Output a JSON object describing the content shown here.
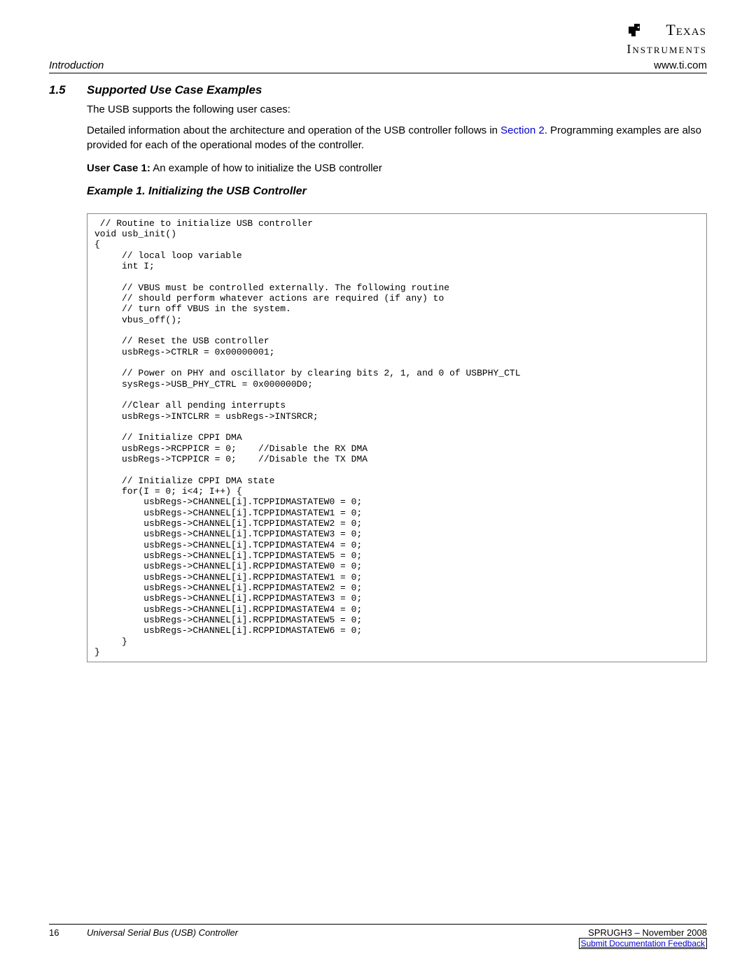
{
  "logo": {
    "line1": "Texas",
    "line2": "Instruments"
  },
  "header": {
    "left": "Introduction",
    "right": "www.ti.com"
  },
  "section": {
    "number": "1.5",
    "title": "Supported Use Case Examples"
  },
  "paragraphs": {
    "p1": "The USB supports the following user cases:",
    "p2a": "Detailed information about the architecture and operation of the USB controller follows in ",
    "p2_link": "Section 2",
    "p2b": ". Programming examples are also provided for each of the operational modes of the controller.",
    "user_case_label": "User Case 1:",
    "user_case_text": " An example of how to initialize the USB controller",
    "example_title": "Example 1. Initializing the USB Controller"
  },
  "code": " // Routine to initialize USB controller\nvoid usb_init()\n{\n     // local loop variable\n     int I;\n\n     // VBUS must be controlled externally. The following routine\n     // should perform whatever actions are required (if any) to\n     // turn off VBUS in the system.\n     vbus_off();\n\n     // Reset the USB controller\n     usbRegs->CTRLR = 0x00000001;\n\n     // Power on PHY and oscillator by clearing bits 2, 1, and 0 of USBPHY_CTL\n     sysRegs->USB_PHY_CTRL = 0x000000D0;\n\n     //Clear all pending interrupts\n     usbRegs->INTCLRR = usbRegs->INTSRCR;\n\n     // Initialize CPPI DMA\n     usbRegs->RCPPICR = 0;    //Disable the RX DMA\n     usbRegs->TCPPICR = 0;    //Disable the TX DMA\n\n     // Initialize CPPI DMA state\n     for(I = 0; i<4; I++) {\n         usbRegs->CHANNEL[i].TCPPIDMASTATEW0 = 0;\n         usbRegs->CHANNEL[i].TCPPIDMASTATEW1 = 0;\n         usbRegs->CHANNEL[i].TCPPIDMASTATEW2 = 0;\n         usbRegs->CHANNEL[i].TCPPIDMASTATEW3 = 0;\n         usbRegs->CHANNEL[i].TCPPIDMASTATEW4 = 0;\n         usbRegs->CHANNEL[i].TCPPIDMASTATEW5 = 0;\n         usbRegs->CHANNEL[i].RCPPIDMASTATEW0 = 0;\n         usbRegs->CHANNEL[i].RCPPIDMASTATEW1 = 0;\n         usbRegs->CHANNEL[i].RCPPIDMASTATEW2 = 0;\n         usbRegs->CHANNEL[i].RCPPIDMASTATEW3 = 0;\n         usbRegs->CHANNEL[i].RCPPIDMASTATEW4 = 0;\n         usbRegs->CHANNEL[i].RCPPIDMASTATEW5 = 0;\n         usbRegs->CHANNEL[i].RCPPIDMASTATEW6 = 0;\n     }\n}",
  "footer": {
    "page": "16",
    "title": "Universal Serial Bus (USB) Controller",
    "doc_id": "SPRUGH3 – November 2008",
    "feedback": "Submit Documentation Feedback"
  }
}
